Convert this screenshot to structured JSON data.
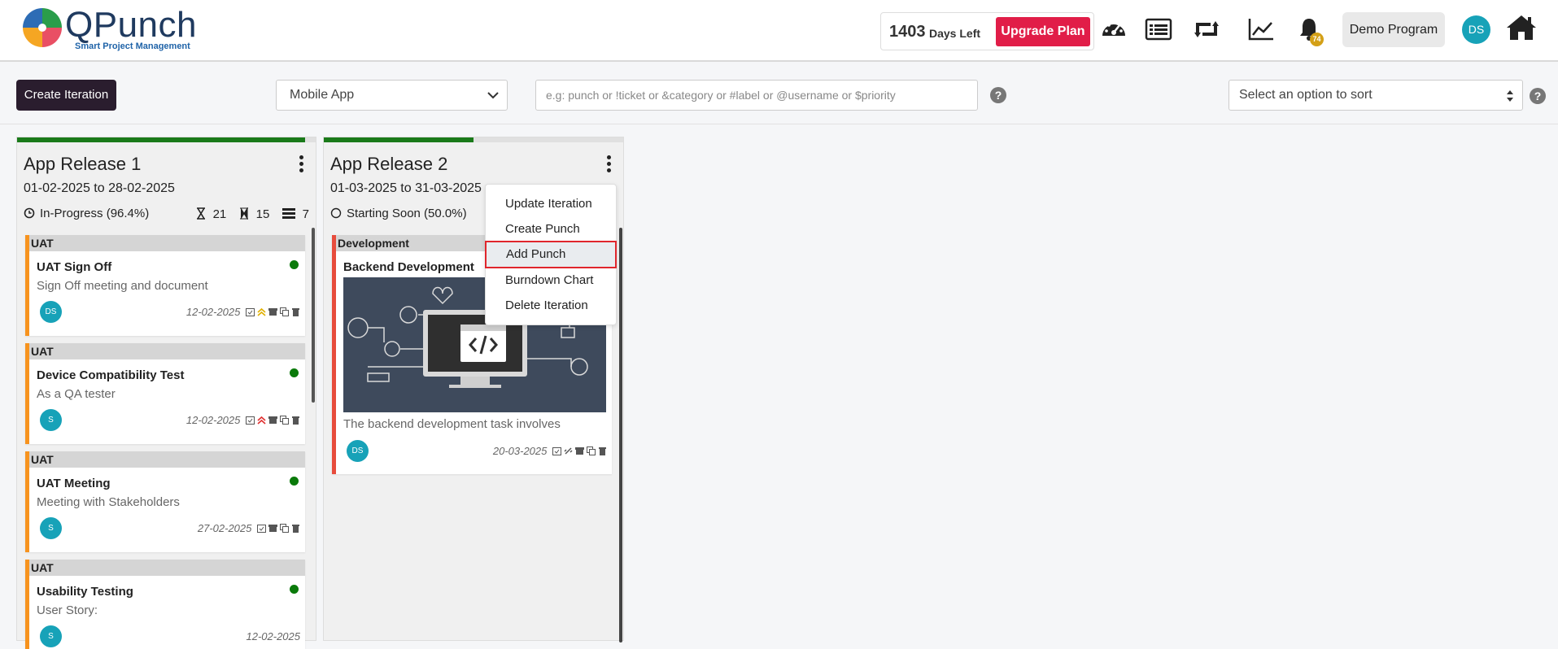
{
  "brand": {
    "name": "QPunch",
    "tagline": "Smart Project Management"
  },
  "header": {
    "days_left_number": "1403",
    "days_left_text": "Days Left",
    "upgrade_label": "Upgrade Plan",
    "notification_count": "74",
    "program_label": "Demo Program",
    "user_initials": "DS",
    "icons": [
      "dashboard-gauge-icon",
      "list-icon",
      "retweet-icon",
      "line-chart-icon",
      "bell-icon",
      "home-icon"
    ]
  },
  "toolbar": {
    "create_iteration_label": "Create Iteration",
    "project_selected": "Mobile App",
    "search_placeholder": "e.g: punch or !ticket or &category or #label or @username or $priority",
    "sort_placeholder": "Select an option to sort"
  },
  "columns": [
    {
      "title": "App Release 1",
      "dates": "01-02-2025 to 28-02-2025",
      "status": "In-Progress (96.4%)",
      "progress": 0.964,
      "stats": {
        "pending": "21",
        "done": "15",
        "total": "7"
      },
      "cards": [
        {
          "category": "UAT",
          "title": "UAT Sign Off",
          "desc": "Sign Off meeting and document",
          "avatar": "DS",
          "date": "12-02-2025"
        },
        {
          "category": "UAT",
          "title": "Device Compatibility Test",
          "desc": "As a QA tester",
          "avatar": "S",
          "date": "12-02-2025"
        },
        {
          "category": "UAT",
          "title": "UAT Meeting",
          "desc": "Meeting with Stakeholders",
          "avatar": "S",
          "date": "27-02-2025"
        },
        {
          "category": "UAT",
          "title": "Usability Testing",
          "desc": "User Story:",
          "avatar": "S",
          "date": "12-02-2025"
        }
      ]
    },
    {
      "title": "App Release 2",
      "dates": "01-03-2025 to 31-03-2025",
      "status": "Starting Soon (50.0%)",
      "progress": 0.5,
      "cards": [
        {
          "category": "Development",
          "title": "Backend Development",
          "desc": "The backend development task involves",
          "avatar": "DS",
          "date": "20-03-2025"
        }
      ]
    }
  ],
  "menu": {
    "items": [
      "Update Iteration",
      "Create Punch",
      "Add Punch",
      "Burndown Chart",
      "Delete Iteration"
    ],
    "active": "Add Punch"
  },
  "colors": {
    "accent": "#e11d48",
    "progress": "#1a7a1a",
    "avatar": "#17a2b8",
    "card_border_uat": "#f7931e",
    "card_border_dev": "#e74c3c"
  }
}
